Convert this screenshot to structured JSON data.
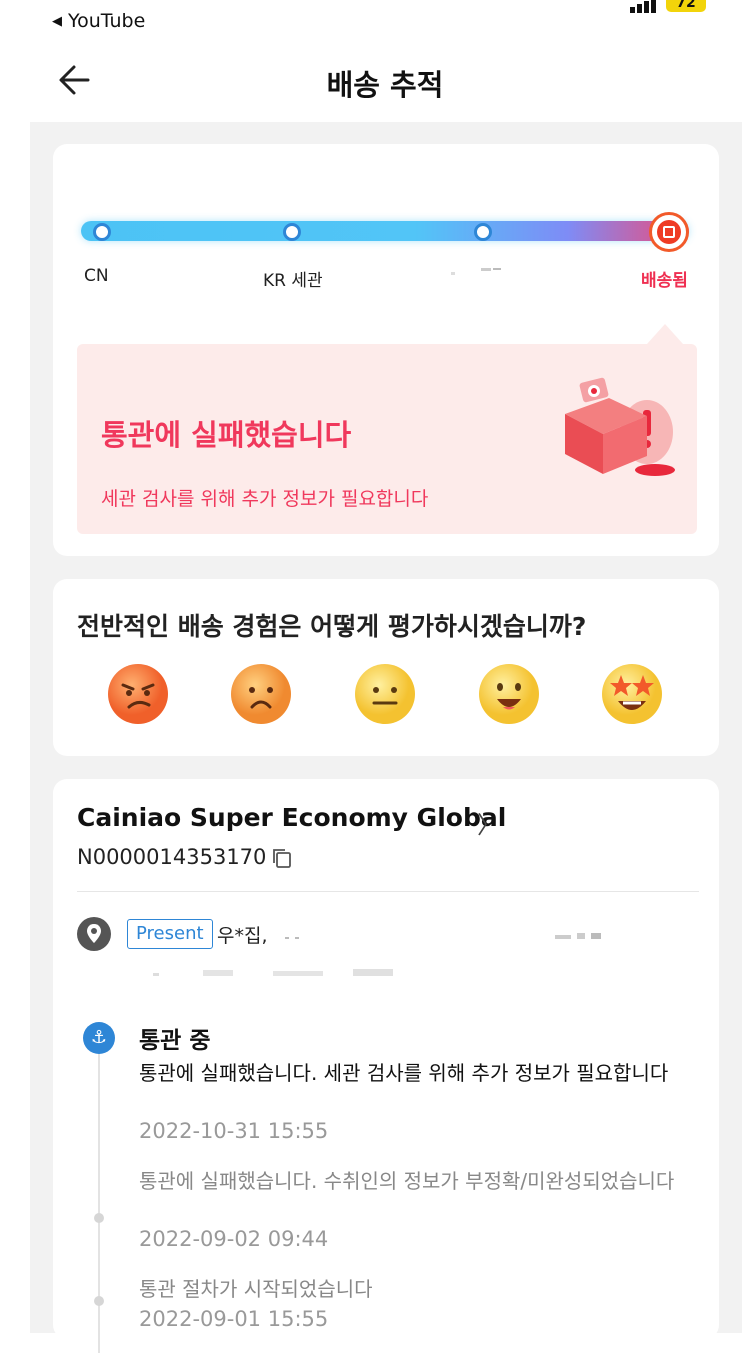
{
  "status_bar": {
    "back_app": "YouTube",
    "battery": "72"
  },
  "nav": {
    "title": "배송 추적"
  },
  "progress": {
    "stages": [
      "CN",
      "KR 세관",
      "",
      "배송됨"
    ],
    "active_stage": "배송됨"
  },
  "alert": {
    "title": "통관에 실패했습니다",
    "description": "세관 검사를 위해 추가 정보가 필요합니다"
  },
  "rating": {
    "question": "전반적인 배송 경험은 어떻게 평가하시겠습니까?",
    "options": [
      "angry-face",
      "frowning-face",
      "neutral-face",
      "smiling-face",
      "star-struck-face"
    ]
  },
  "shipment": {
    "carrier": "Cainiao Super Economy Global",
    "tracking_number": "N0000014353170",
    "address_badge": "Present",
    "address": "우*집,"
  },
  "timeline": [
    {
      "status": "통관 중",
      "text": "통관에 실패했습니다. 세관 검사를 위해 추가 정보가 필요합니다",
      "time": "2022-10-31 15:55"
    },
    {
      "text": "통관에 실패했습니다. 수취인의 정보가 부정확/미완성되었습니다",
      "time": "2022-09-02 09:44"
    },
    {
      "text": "통관 절차가 시작되었습니다",
      "time": "2022-09-01 15:55"
    }
  ],
  "colors": {
    "accent_red": "#f0385c",
    "accent_blue": "#2e86d6",
    "bg_grey": "#f2f2f2"
  }
}
